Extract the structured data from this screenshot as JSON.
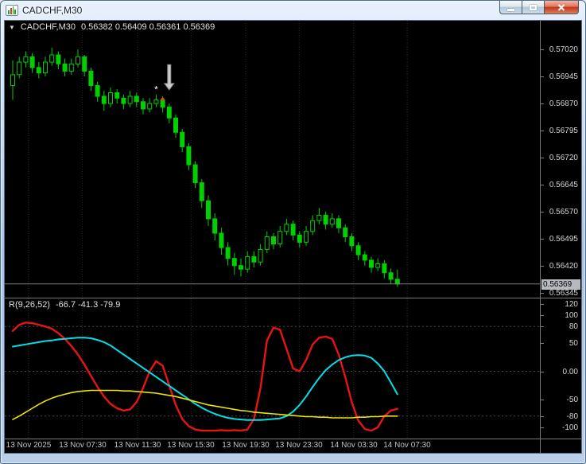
{
  "window": {
    "title": "CADCHF,M30"
  },
  "chart": {
    "label_arrow": "▼",
    "symbol_period": "CADCHF,M30",
    "ohlc_text": "0.56382 0.56409 0.56361 0.56369"
  },
  "indicator": {
    "name": "R(9,26,52)",
    "values_text": "-66.7 -41.3 -79.9"
  },
  "colors": {
    "background": "#000000",
    "candle_outline": "#00d000",
    "candle_bull_fill": "#000000",
    "candle_bear_fill": "#00d000",
    "grid": "#263026",
    "level_line": "#4a4a4a",
    "axis_text": "#d4d4d4",
    "price_line": "#7d7d7d",
    "badge_bg": "#b6babf",
    "arrow_marker": "#cccccc",
    "dot_marker": "#ff3b30",
    "star_marker": "#ffffff"
  },
  "chart_data": [
    {
      "type": "candlestick",
      "title": "CADCHF,M30",
      "ylim": [
        0.56331,
        0.571
      ],
      "y_ticks": [
        "0.57020",
        "0.56945",
        "0.56870",
        "0.56795",
        "0.56720",
        "0.56645",
        "0.56570",
        "0.56495",
        "0.56420",
        "0.56345"
      ],
      "x_labels": [
        {
          "text": "13 Nov 2025",
          "x": 0.044
        },
        {
          "text": "13 Nov 07:30",
          "x": 0.145
        },
        {
          "text": "13 Nov 11:30",
          "x": 0.248
        },
        {
          "text": "13 Nov 15:30",
          "x": 0.348
        },
        {
          "text": "13 Nov 19:30",
          "x": 0.45
        },
        {
          "text": "13 Nov 23:30",
          "x": 0.55
        },
        {
          "text": "14 Nov 03:30",
          "x": 0.652
        },
        {
          "text": "14 Nov 07:30",
          "x": 0.752
        }
      ],
      "x_start": 10,
      "x_step": 8.2,
      "candle_width": 5,
      "current_price": 0.56369,
      "current_price_label": "0.56369",
      "grid": "vertical-dotted",
      "candles": [
        [
          0.5692,
          0.5699,
          0.5688,
          0.5695
        ],
        [
          0.5695,
          0.57,
          0.5694,
          0.56985
        ],
        [
          0.56985,
          0.57015,
          0.5697,
          0.57
        ],
        [
          0.57,
          0.5701,
          0.56955,
          0.5697
        ],
        [
          0.5697,
          0.56985,
          0.5694,
          0.56955
        ],
        [
          0.56955,
          0.57,
          0.56945,
          0.56985
        ],
        [
          0.56985,
          0.57025,
          0.56975,
          0.57005
        ],
        [
          0.57005,
          0.57015,
          0.56965,
          0.5698
        ],
        [
          0.5698,
          0.56995,
          0.56945,
          0.5696
        ],
        [
          0.5696,
          0.56995,
          0.5695,
          0.5698
        ],
        [
          0.5698,
          0.5702,
          0.5697,
          0.57
        ],
        [
          0.57,
          0.57005,
          0.56945,
          0.5696
        ],
        [
          0.5696,
          0.5697,
          0.56905,
          0.5692
        ],
        [
          0.5692,
          0.5693,
          0.56875,
          0.5689
        ],
        [
          0.5689,
          0.56905,
          0.5685,
          0.5687
        ],
        [
          0.5687,
          0.56915,
          0.5686,
          0.569
        ],
        [
          0.569,
          0.5691,
          0.5687,
          0.56885
        ],
        [
          0.56885,
          0.56895,
          0.56855,
          0.5687
        ],
        [
          0.5687,
          0.56905,
          0.5686,
          0.5689
        ],
        [
          0.5689,
          0.569,
          0.5686,
          0.56875
        ],
        [
          0.56875,
          0.56885,
          0.5684,
          0.56855
        ],
        [
          0.56855,
          0.56885,
          0.56845,
          0.5687
        ],
        [
          0.5687,
          0.56895,
          0.5686,
          0.5688
        ],
        [
          0.5688,
          0.5689,
          0.56845,
          0.5686
        ],
        [
          0.5686,
          0.5687,
          0.56815,
          0.5683
        ],
        [
          0.5683,
          0.5684,
          0.56775,
          0.5679
        ],
        [
          0.5679,
          0.568,
          0.56735,
          0.5675
        ],
        [
          0.5675,
          0.5676,
          0.56685,
          0.567
        ],
        [
          0.567,
          0.5671,
          0.56635,
          0.5665
        ],
        [
          0.5665,
          0.5666,
          0.5658,
          0.566
        ],
        [
          0.566,
          0.56615,
          0.5653,
          0.5655
        ],
        [
          0.5655,
          0.56565,
          0.5649,
          0.5651
        ],
        [
          0.5651,
          0.56525,
          0.5645,
          0.5647
        ],
        [
          0.5647,
          0.56485,
          0.5642,
          0.5644
        ],
        [
          0.5644,
          0.56455,
          0.56395,
          0.5642
        ],
        [
          0.5642,
          0.5644,
          0.5639,
          0.5641
        ],
        [
          0.5641,
          0.5646,
          0.564,
          0.56445
        ],
        [
          0.56445,
          0.5646,
          0.56415,
          0.5643
        ],
        [
          0.5643,
          0.5648,
          0.5642,
          0.56465
        ],
        [
          0.56465,
          0.56515,
          0.56455,
          0.565
        ],
        [
          0.565,
          0.5651,
          0.56465,
          0.5648
        ],
        [
          0.5648,
          0.5653,
          0.5647,
          0.56515
        ],
        [
          0.56515,
          0.5655,
          0.56505,
          0.56535
        ],
        [
          0.56535,
          0.56545,
          0.5649,
          0.56505
        ],
        [
          0.56505,
          0.56515,
          0.5647,
          0.56485
        ],
        [
          0.56485,
          0.5653,
          0.56475,
          0.56515
        ],
        [
          0.56515,
          0.5656,
          0.56505,
          0.56545
        ],
        [
          0.56545,
          0.5658,
          0.56535,
          0.5656
        ],
        [
          0.5656,
          0.5657,
          0.5652,
          0.56535
        ],
        [
          0.56535,
          0.56565,
          0.56525,
          0.5655
        ],
        [
          0.5655,
          0.5656,
          0.5651,
          0.56525
        ],
        [
          0.56525,
          0.56535,
          0.56485,
          0.565
        ],
        [
          0.565,
          0.5651,
          0.5646,
          0.56475
        ],
        [
          0.56475,
          0.56485,
          0.56435,
          0.5645
        ],
        [
          0.5645,
          0.5646,
          0.5642,
          0.56435
        ],
        [
          0.56435,
          0.56445,
          0.564,
          0.56415
        ],
        [
          0.56415,
          0.5644,
          0.56405,
          0.56425
        ],
        [
          0.56425,
          0.56435,
          0.56385,
          0.564
        ],
        [
          0.564,
          0.56412,
          0.56368,
          0.56382
        ],
        [
          0.56382,
          0.56409,
          0.56361,
          0.56369
        ]
      ],
      "annotations": {
        "down_arrow": {
          "index": 24,
          "price_top": 0.56978,
          "price_tip": 0.56908
        },
        "star": {
          "index": 22,
          "price": 0.569,
          "glyph": "*"
        },
        "dot": {
          "index": 23,
          "price": 0.56882
        }
      }
    },
    {
      "type": "line",
      "title": "R(9,26,52)",
      "ylim": [
        -120,
        130
      ],
      "y_ticks": [
        "120",
        "100",
        "80",
        "50",
        "0.00",
        "-50",
        "-80",
        "-100"
      ],
      "levels": [
        80,
        0,
        -80
      ],
      "legend_position": "none",
      "series": [
        {
          "name": "red-line",
          "color": "#e81414",
          "width": 2.4,
          "values": [
            72,
            83,
            87,
            86,
            83,
            80,
            76,
            68,
            58,
            45,
            30,
            12,
            -8,
            -28,
            -45,
            -58,
            -66,
            -70,
            -68,
            -55,
            -30,
            0,
            18,
            10,
            -25,
            -60,
            -85,
            -98,
            -104,
            -106,
            -106,
            -106,
            -105,
            -106,
            -105,
            -106,
            -104,
            -85,
            -30,
            55,
            78,
            74,
            40,
            5,
            0,
            20,
            48,
            60,
            62,
            58,
            30,
            -10,
            -55,
            -88,
            -103,
            -106,
            -100,
            -80,
            -70,
            -67
          ]
        },
        {
          "name": "cyan-line",
          "color": "#00e0e8",
          "width": 2,
          "values": [
            44,
            46,
            48,
            50,
            52,
            54,
            55,
            57,
            58,
            59,
            60,
            60,
            59,
            56,
            52,
            46,
            38,
            30,
            22,
            14,
            6,
            -2,
            -10,
            -18,
            -26,
            -34,
            -42,
            -50,
            -58,
            -65,
            -71,
            -76,
            -80,
            -83,
            -85,
            -86,
            -87,
            -87,
            -87,
            -86,
            -85,
            -84,
            -80,
            -72,
            -60,
            -45,
            -28,
            -12,
            2,
            12,
            20,
            25,
            28,
            29,
            28,
            24,
            14,
            0,
            -20,
            -41
          ]
        },
        {
          "name": "yellow-line",
          "color": "#efe400",
          "width": 1.6,
          "values": [
            -86,
            -80,
            -73,
            -66,
            -59,
            -53,
            -48,
            -44,
            -41,
            -38,
            -36,
            -35,
            -34,
            -34,
            -34,
            -34,
            -34,
            -35,
            -35,
            -36,
            -37,
            -38,
            -39,
            -41,
            -43,
            -45,
            -48,
            -51,
            -54,
            -57,
            -60,
            -62,
            -64,
            -66,
            -68,
            -70,
            -71,
            -73,
            -74,
            -75,
            -76,
            -77,
            -78,
            -79,
            -80,
            -81,
            -81,
            -82,
            -82,
            -83,
            -83,
            -83,
            -83,
            -82,
            -82,
            -81,
            -81,
            -80,
            -80,
            -80
          ]
        }
      ]
    }
  ]
}
